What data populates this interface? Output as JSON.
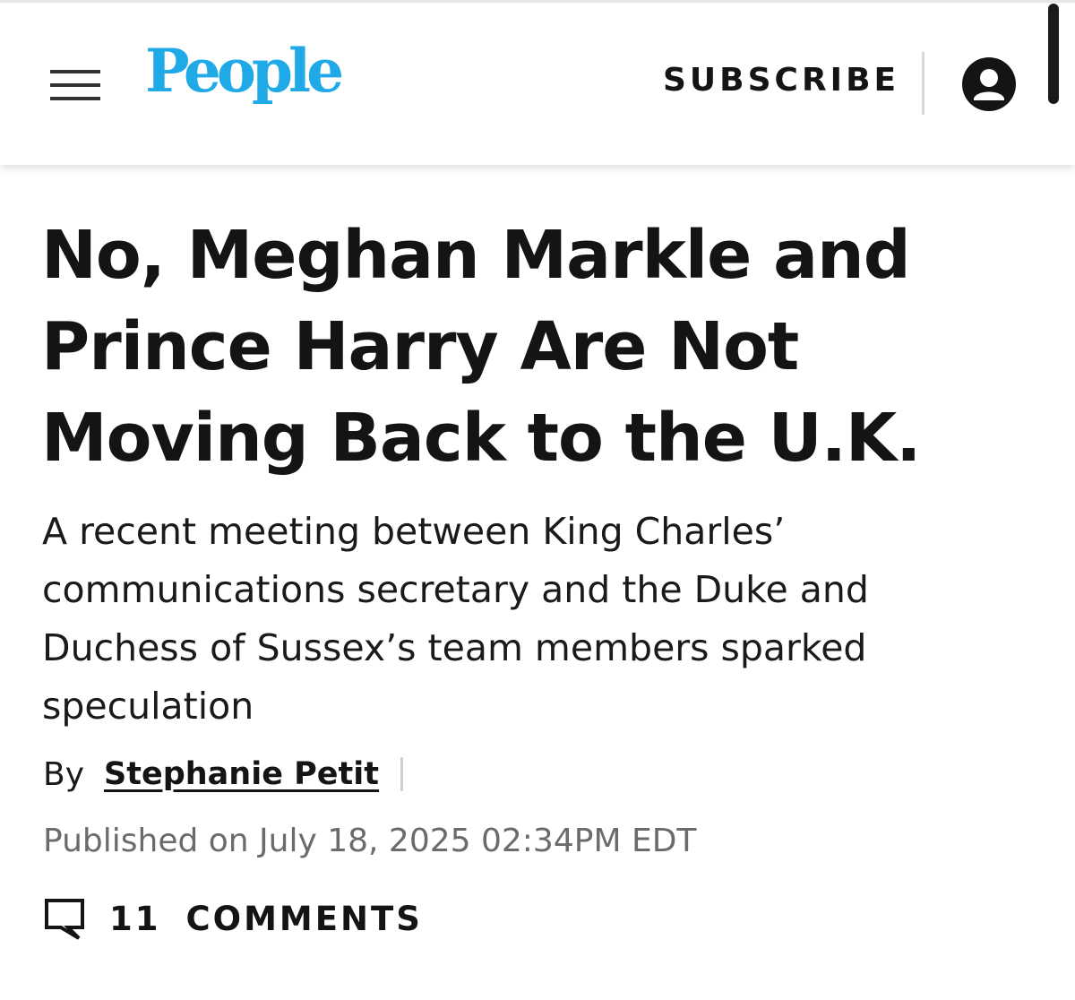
{
  "header": {
    "logo_text": "People",
    "subscribe_label": "SUBSCRIBE",
    "menu_icon": "hamburger-menu-icon",
    "account_icon": "account-circle-icon",
    "brand_color": "#1fa9e6"
  },
  "article": {
    "headline": "No, Meghan Markle and Prince Harry Are Not Moving Back to the U.K.",
    "dek": "A recent meeting between King Charles’ communications secretary and the Duke and Duchess of Sussex’s team members sparked speculation",
    "byline_prefix": "By",
    "author": "Stephanie Petit",
    "published": "Published on July 18, 2025 02:34PM EDT",
    "comments_count": "11",
    "comments_label": "COMMENTS",
    "comments_icon": "comment-bubble-icon"
  }
}
